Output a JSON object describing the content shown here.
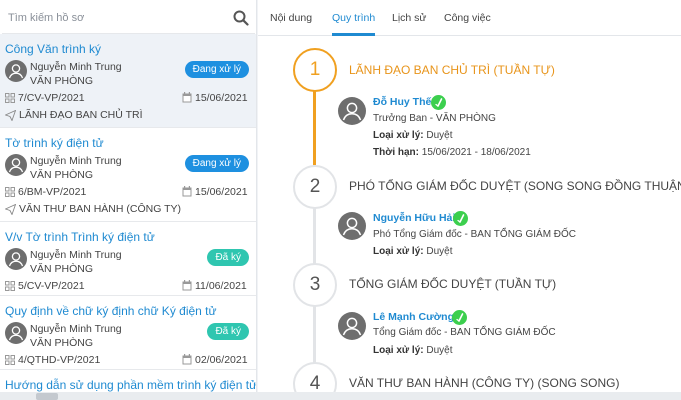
{
  "search": {
    "placeholder": "Tìm kiếm hồ sơ",
    "icon": "search-icon"
  },
  "documents": [
    {
      "title": "Công Văn trình ký",
      "user": "Nguyễn Minh Trung",
      "dept": "VĂN PHÒNG",
      "status": "Đang xử lý",
      "code": "7/CV-VP/2021",
      "date": "15/06/2021",
      "step": "LÃNH ĐẠO BAN CHỦ TRÌ"
    },
    {
      "title": "Tờ trình ký điện tử",
      "user": "Nguyễn Minh Trung",
      "dept": "VĂN PHÒNG",
      "status": "Đang xử lý",
      "code": "6/BM-VP/2021",
      "date": "15/06/2021",
      "step": "VĂN THƯ BAN HÀNH (CÔNG TY)"
    },
    {
      "title": "V/v Tờ trình Trình ký điện tử",
      "user": "Nguyễn Minh Trung",
      "dept": "VĂN PHÒNG",
      "status": "Đã ký",
      "code": "5/CV-VP/2021",
      "date": "11/06/2021"
    },
    {
      "title": "Quy định về chữ ký định chữ Ký điện tử",
      "user": "Nguyễn Minh Trung",
      "dept": "VĂN PHÒNG",
      "status": "Đã ký",
      "code": "4/QTHD-VP/2021",
      "date": "02/06/2021"
    },
    {
      "title": "Hướng dẫn sử dụng phần mềm trình ký điện tử"
    }
  ],
  "tabs": [
    "Nội dung",
    "Quy trình",
    "Lịch sử",
    "Công việc"
  ],
  "active_tab": "Quy trình",
  "steps": [
    {
      "number": "1",
      "title": "LÃNH ĐẠO BAN CHỦ TRÌ (TUẦN TỰ)",
      "name": "Đỗ Huy Thế",
      "role": "Trưởng Ban - VĂN PHÒNG",
      "type_label": "Loại xử lý:",
      "type": "Duyệt",
      "deadline_label": "Thời hạn:",
      "deadline": "15/06/2021 - 18/06/2021"
    },
    {
      "number": "2",
      "title": "PHÓ TỔNG GIÁM ĐỐC DUYỆT (SONG SONG ĐỒNG THUẬN)",
      "name": "Nguyễn Hữu Hải",
      "role": "Phó Tổng Giám đốc - BAN TỔNG GIÁM ĐỐC",
      "type_label": "Loại xử lý:",
      "type": "Duyệt"
    },
    {
      "number": "3",
      "title": "TỔNG GIÁM ĐỐC DUYỆT (TUẦN TỰ)",
      "name": "Lê Mạnh Cường",
      "role": "Tổng Giám đốc - BAN TỔNG GIÁM ĐỐC",
      "type_label": "Loại xử lý:",
      "type": "Duyệt"
    },
    {
      "number": "4",
      "title": "VĂN THƯ BAN HÀNH (CÔNG TY) (SONG SONG)"
    }
  ],
  "colors": {
    "accent": "#1f8ad1",
    "current_step": "#f0a020",
    "badge_processing": "#1e90e0",
    "badge_signed": "#2fc6b0",
    "check": "#3ccf4e"
  }
}
